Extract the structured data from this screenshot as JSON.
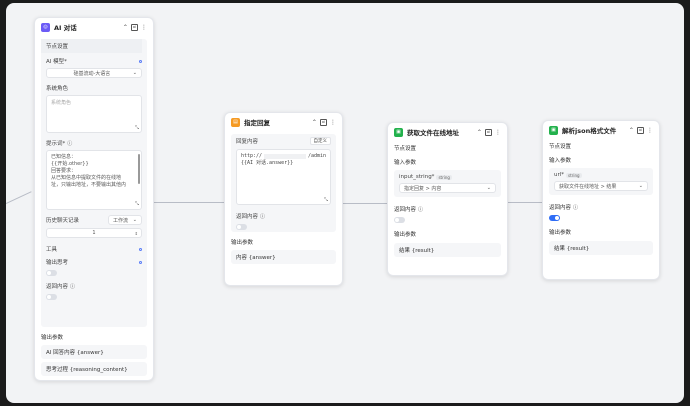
{
  "colors": {
    "ai": "#6b5bf6",
    "reply": "#f59a23",
    "get": "#22b14c",
    "parse": "#22b14c",
    "accent": "#2f6df6"
  },
  "node_ai": {
    "title": "AI 对话",
    "section_node_settings": "节点设置",
    "model_label": "AI 模型*",
    "model_value": "硅基流动-大语言",
    "system_label": "系统角色",
    "system_placeholder": "系统角色",
    "prompt_label": "提示词*",
    "prompt_lines": [
      "已知信息：",
      "{{开始.other}}",
      "回答要求：",
      "从已知信息中提取文件的在线地",
      "址，只输出地址，不要输出其他内"
    ],
    "history_label": "历史聊天记录",
    "history_mode": "工作流",
    "history_count": "1",
    "tools_label": "工具",
    "think_label": "输出思考",
    "return_label": "返回内容",
    "output_label": "输出参数",
    "output_1": "AI 回答内容 {answer}",
    "output_2": "思考过程 {reasoning_content}"
  },
  "node_reply": {
    "title": "指定回复",
    "reply_label": "回复内容",
    "custom_btn": "自定义",
    "code_line1_a": "http://",
    "code_line1_b": "/admin",
    "code_line2": "{{AI 对话.answer}}",
    "return_label": "返回内容",
    "output_label": "输出参数",
    "output_1": "内容 {answer}"
  },
  "node_get": {
    "title": "获取文件在线地址",
    "section_node_settings": "节点设置",
    "input_label": "输入参数",
    "param_name": "input_string*",
    "param_type": "string",
    "param_value": "指定回复 > 内容",
    "return_label": "返回内容",
    "output_label": "输出参数",
    "output_1": "结果 {result}"
  },
  "node_parse": {
    "title": "解析json格式文件",
    "section_node_settings": "节点设置",
    "input_label": "输入参数",
    "param_name": "url*",
    "param_type": "string",
    "param_value": "获取文件在线地址 > 结果",
    "return_label": "返回内容",
    "output_label": "输出参数",
    "output_1": "结果 {result}"
  }
}
